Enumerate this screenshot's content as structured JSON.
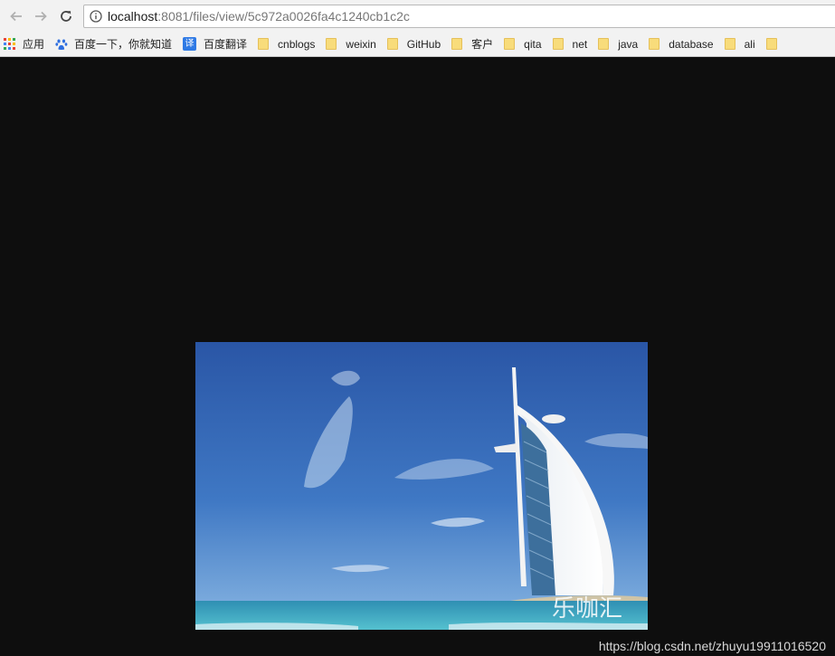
{
  "browser": {
    "url_host": "localhost",
    "url_rest": ":8081/files/view/5c972a0026fa4c1240cb1c2c"
  },
  "bookmarks": [
    {
      "label": "应用",
      "icon": "apps-grid-icon"
    },
    {
      "label": "百度一下，你就知道",
      "icon": "baidu-paw-icon"
    },
    {
      "label": "百度翻译",
      "icon": "translate-icon",
      "icon_text": "译"
    },
    {
      "label": "cnblogs",
      "icon": "folder-icon"
    },
    {
      "label": "weixin",
      "icon": "folder-icon"
    },
    {
      "label": "GitHub",
      "icon": "folder-icon"
    },
    {
      "label": "客户",
      "icon": "folder-icon"
    },
    {
      "label": "qita",
      "icon": "folder-icon"
    },
    {
      "label": "net",
      "icon": "folder-icon"
    },
    {
      "label": "java",
      "icon": "folder-icon"
    },
    {
      "label": "database",
      "icon": "folder-icon"
    },
    {
      "label": "ali",
      "icon": "folder-icon"
    }
  ],
  "image": {
    "overlay_text": "乐咖汇"
  },
  "watermark": "https://blog.csdn.net/zhuyu19911016520",
  "colors": {
    "page_background": "#0e0e0e",
    "sky_top": "#2a56a6",
    "sea": "#3aa6c4",
    "folder": "#f8dc7b"
  }
}
